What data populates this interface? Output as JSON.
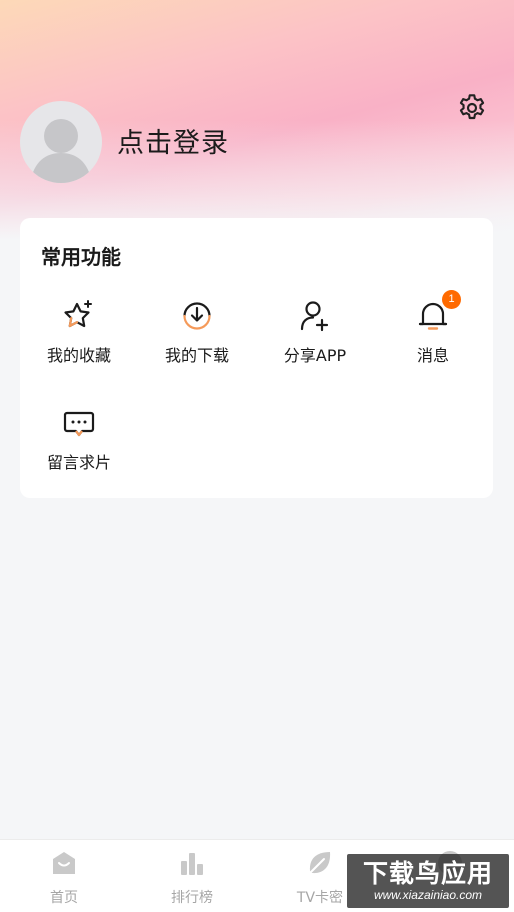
{
  "header": {
    "login_label": "点击登录",
    "settings_icon": "gear-icon",
    "avatar_icon": "default-user-avatar"
  },
  "functions": {
    "title": "常用功能",
    "items": [
      {
        "label": "我的收藏",
        "icon": "star-icon"
      },
      {
        "label": "我的下载",
        "icon": "download-icon"
      },
      {
        "label": "分享APP",
        "icon": "user-add-icon"
      },
      {
        "label": "消息",
        "icon": "bell-icon",
        "badge": "1"
      },
      {
        "label": "留言求片",
        "icon": "chat-bubble-icon"
      }
    ]
  },
  "tabbar": {
    "items": [
      {
        "label": "首页",
        "icon": "home-icon"
      },
      {
        "label": "排行榜",
        "icon": "bar-chart-icon"
      },
      {
        "label": "TV卡密",
        "icon": "leaf-icon"
      },
      {
        "label": "",
        "icon": "profile-icon"
      }
    ]
  },
  "watermark": {
    "title": "下载鸟应用",
    "url": "www.xiazainiao.com"
  },
  "colors": {
    "badge": "#ff6a00",
    "accent_orange": "#f59a5a",
    "tab_inactive": "#a6a6a6"
  }
}
